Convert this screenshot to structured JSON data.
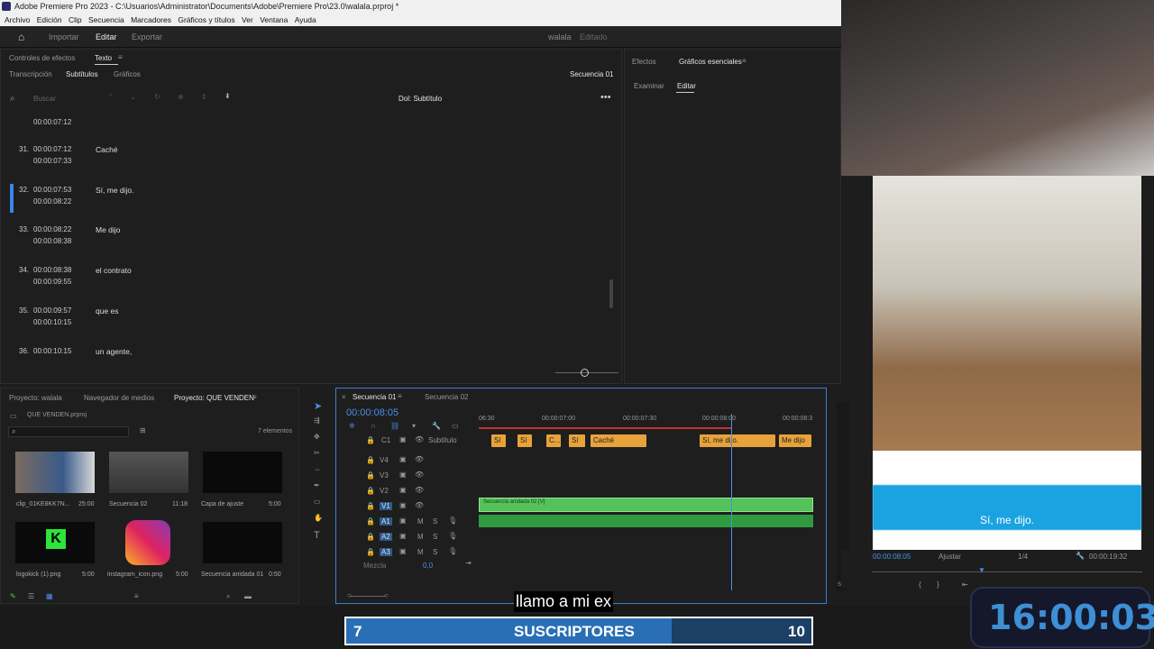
{
  "app": {
    "title": "Adobe Premiere Pro 2023 - C:\\Usuarios\\Administrator\\Documents\\Adobe\\Premiere Pro\\23.0\\walala.prproj *",
    "menu": [
      "Archivo",
      "Edición",
      "Clip",
      "Secuencia",
      "Marcadores",
      "Gráficos y títulos",
      "Ver",
      "Ventana",
      "Ayuda"
    ],
    "workspace": [
      "Importar",
      "Editar",
      "Exportar"
    ],
    "project_title": "walala",
    "project_status": "Editado"
  },
  "text_panel": {
    "tabs": [
      "Controles de efectos",
      "Texto"
    ],
    "subtabs": [
      "Transcripción",
      "Subtítulos",
      "Gráficos"
    ],
    "sequence": "Secuencia 01",
    "search": "Buscar",
    "track": "Dol: Subtítulo",
    "top_time": "00:00:07:12",
    "rows": [
      {
        "n": "31.",
        "in": "00:00:07:12",
        "out": "00:00:07:33",
        "text": "Caché"
      },
      {
        "n": "32.",
        "in": "00:00:07:53",
        "out": "00:00:08:22",
        "text": "Sí, me dijo."
      },
      {
        "n": "33.",
        "in": "00:00:08:22",
        "out": "00:00:08:38",
        "text": "Me dijo"
      },
      {
        "n": "34.",
        "in": "00:00:08:38",
        "out": "00:00:09:55",
        "text": "el contrato"
      },
      {
        "n": "35.",
        "in": "00:00:09:57",
        "out": "00:00:10:15",
        "text": "que es"
      },
      {
        "n": "36.",
        "in": "00:00:10:15",
        "out": "",
        "text": "un agente,"
      }
    ]
  },
  "graphics_panel": {
    "tabs": [
      "Efectos",
      "Gráficos esenciales"
    ],
    "subtabs": [
      "Examinar",
      "Editar"
    ]
  },
  "project_panel": {
    "tabs": [
      "Proyecto: walala",
      "Navegador de medios",
      "Proyecto: QUE VENDEN"
    ],
    "file": "QUE VENDEN.prproj",
    "count": "7 elementos",
    "items": [
      {
        "name": "clip_01KE8KK7N...",
        "dur": "25:00"
      },
      {
        "name": "Secuencia 02",
        "dur": "11:18"
      },
      {
        "name": "Capa de ajuste",
        "dur": "5:00"
      },
      {
        "name": "logokick (1).png",
        "dur": "5:00"
      },
      {
        "name": "instagram_icon.png",
        "dur": "5:00"
      },
      {
        "name": "Secuencia anidada 01",
        "dur": "0:50"
      }
    ]
  },
  "timeline": {
    "tabs": [
      "Secuencia 01",
      "Secuencia 02"
    ],
    "timecode": "00:00:08:05",
    "ruler": [
      "06:30",
      "00:00:07:00",
      "00:00:07:30",
      "00:00:08:00",
      "00:00:08:3"
    ],
    "subtitle_track": "Subtítulo",
    "caption_track": "C1",
    "captions": [
      "Sí",
      "Sí",
      "C...",
      "Sí",
      "Caché",
      "Sí, me dijo.",
      "Me dijo"
    ],
    "video_tracks": [
      "V4",
      "V3",
      "V2",
      "V1"
    ],
    "audio_tracks": [
      "A1",
      "A2",
      "A3"
    ],
    "clip": "Secuencia anidada 02 [V]",
    "mix": "Mezcla",
    "mix_val": "0,0"
  },
  "program": {
    "caption": "Sí, me dijo.",
    "timecode": "00:00:08:05",
    "fit": "Ajustar",
    "ratio": "1/4",
    "duration": "00:00:19:32"
  },
  "overlay": {
    "subtitle": "llamo a mi ex",
    "timer": "16:00:03",
    "goal_current": "7",
    "goal_label": "SUSCRIPTORES",
    "goal_target": "10",
    "goal_fraction": 0.7
  },
  "colors": {
    "caption": "#e8a23a",
    "video_clip": "#56c25a",
    "playhead": "#4b8fe6",
    "accent": "#2a6fb5"
  }
}
